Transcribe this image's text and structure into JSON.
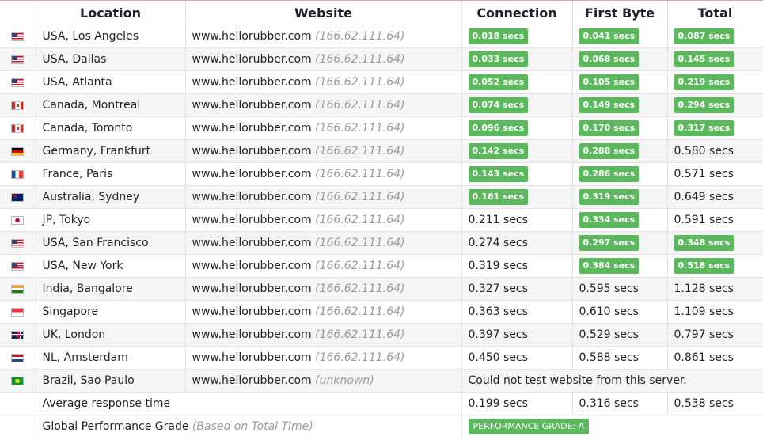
{
  "headers": [
    "Location",
    "Website",
    "Connection",
    "First Byte",
    "Total"
  ],
  "rows": [
    {
      "flag": "us-flag-icon",
      "flag_class": "f-us",
      "location": "USA, Los Angeles",
      "site": "www.hellorubber.com",
      "ip": "(166.62.111.64)",
      "connection": {
        "text": "0.018 secs",
        "badge": true
      },
      "first_byte": {
        "text": "0.041 secs",
        "badge": true
      },
      "total": {
        "text": "0.087 secs",
        "badge": true
      }
    },
    {
      "flag": "us-flag-icon",
      "flag_class": "f-us",
      "location": "USA, Dallas",
      "site": "www.hellorubber.com",
      "ip": "(166.62.111.64)",
      "connection": {
        "text": "0.033 secs",
        "badge": true
      },
      "first_byte": {
        "text": "0.068 secs",
        "badge": true
      },
      "total": {
        "text": "0.145 secs",
        "badge": true
      }
    },
    {
      "flag": "us-flag-icon",
      "flag_class": "f-us",
      "location": "USA, Atlanta",
      "site": "www.hellorubber.com",
      "ip": "(166.62.111.64)",
      "connection": {
        "text": "0.052 secs",
        "badge": true
      },
      "first_byte": {
        "text": "0.105 secs",
        "badge": true
      },
      "total": {
        "text": "0.219 secs",
        "badge": true
      }
    },
    {
      "flag": "canada-flag-icon",
      "flag_class": "f-ca",
      "location": "Canada, Montreal",
      "site": "www.hellorubber.com",
      "ip": "(166.62.111.64)",
      "connection": {
        "text": "0.074 secs",
        "badge": true
      },
      "first_byte": {
        "text": "0.149 secs",
        "badge": true
      },
      "total": {
        "text": "0.294 secs",
        "badge": true
      }
    },
    {
      "flag": "canada-flag-icon",
      "flag_class": "f-ca",
      "location": "Canada, Toronto",
      "site": "www.hellorubber.com",
      "ip": "(166.62.111.64)",
      "connection": {
        "text": "0.096 secs",
        "badge": true
      },
      "first_byte": {
        "text": "0.170 secs",
        "badge": true
      },
      "total": {
        "text": "0.317 secs",
        "badge": true
      }
    },
    {
      "flag": "germany-flag-icon",
      "flag_class": "f-de",
      "location": "Germany, Frankfurt",
      "site": "www.hellorubber.com",
      "ip": "(166.62.111.64)",
      "connection": {
        "text": "0.142 secs",
        "badge": true
      },
      "first_byte": {
        "text": "0.288 secs",
        "badge": true
      },
      "total": {
        "text": "0.580 secs",
        "badge": false
      }
    },
    {
      "flag": "france-flag-icon",
      "flag_class": "f-fr",
      "location": "France, Paris",
      "site": "www.hellorubber.com",
      "ip": "(166.62.111.64)",
      "connection": {
        "text": "0.143 secs",
        "badge": true
      },
      "first_byte": {
        "text": "0.286 secs",
        "badge": true
      },
      "total": {
        "text": "0.571 secs",
        "badge": false
      }
    },
    {
      "flag": "australia-flag-icon",
      "flag_class": "f-au",
      "location": "Australia, Sydney",
      "site": "www.hellorubber.com",
      "ip": "(166.62.111.64)",
      "connection": {
        "text": "0.161 secs",
        "badge": true
      },
      "first_byte": {
        "text": "0.319 secs",
        "badge": true
      },
      "total": {
        "text": "0.649 secs",
        "badge": false
      }
    },
    {
      "flag": "japan-flag-icon",
      "flag_class": "f-jp",
      "location": "JP, Tokyo",
      "site": "www.hellorubber.com",
      "ip": "(166.62.111.64)",
      "connection": {
        "text": "0.211 secs",
        "badge": false
      },
      "first_byte": {
        "text": "0.334 secs",
        "badge": true
      },
      "total": {
        "text": "0.591 secs",
        "badge": false
      }
    },
    {
      "flag": "us-flag-icon",
      "flag_class": "f-us",
      "location": "USA, San Francisco",
      "site": "www.hellorubber.com",
      "ip": "(166.62.111.64)",
      "connection": {
        "text": "0.274 secs",
        "badge": false
      },
      "first_byte": {
        "text": "0.297 secs",
        "badge": true
      },
      "total": {
        "text": "0.348 secs",
        "badge": true
      }
    },
    {
      "flag": "us-flag-icon",
      "flag_class": "f-us",
      "location": "USA, New York",
      "site": "www.hellorubber.com",
      "ip": "(166.62.111.64)",
      "connection": {
        "text": "0.319 secs",
        "badge": false
      },
      "first_byte": {
        "text": "0.384 secs",
        "badge": true
      },
      "total": {
        "text": "0.518 secs",
        "badge": true
      }
    },
    {
      "flag": "india-flag-icon",
      "flag_class": "f-in",
      "location": "India, Bangalore",
      "site": "www.hellorubber.com",
      "ip": "(166.62.111.64)",
      "connection": {
        "text": "0.327 secs",
        "badge": false
      },
      "first_byte": {
        "text": "0.595 secs",
        "badge": false
      },
      "total": {
        "text": "1.128 secs",
        "badge": false
      }
    },
    {
      "flag": "singapore-flag-icon",
      "flag_class": "f-sg",
      "location": "Singapore",
      "site": "www.hellorubber.com",
      "ip": "(166.62.111.64)",
      "connection": {
        "text": "0.363 secs",
        "badge": false
      },
      "first_byte": {
        "text": "0.610 secs",
        "badge": false
      },
      "total": {
        "text": "1.109 secs",
        "badge": false
      }
    },
    {
      "flag": "uk-flag-icon",
      "flag_class": "f-uk",
      "location": "UK, London",
      "site": "www.hellorubber.com",
      "ip": "(166.62.111.64)",
      "connection": {
        "text": "0.397 secs",
        "badge": false
      },
      "first_byte": {
        "text": "0.529 secs",
        "badge": false
      },
      "total": {
        "text": "0.797 secs",
        "badge": false
      }
    },
    {
      "flag": "netherlands-flag-icon",
      "flag_class": "f-nl",
      "location": "NL, Amsterdam",
      "site": "www.hellorubber.com",
      "ip": "(166.62.111.64)",
      "connection": {
        "text": "0.450 secs",
        "badge": false
      },
      "first_byte": {
        "text": "0.588 secs",
        "badge": false
      },
      "total": {
        "text": "0.861 secs",
        "badge": false
      }
    },
    {
      "flag": "brazil-flag-icon",
      "flag_class": "f-br",
      "location": "Brazil, Sao Paulo",
      "site": "www.hellorubber.com",
      "ip": "(unknown)",
      "error": "Could not test website from this server."
    }
  ],
  "average": {
    "label": "Average response time",
    "connection": "0.199 secs",
    "first_byte": "0.316 secs",
    "total": "0.538 secs"
  },
  "grade": {
    "label": "Global Performance Grade",
    "note": "(Based on Total Time)",
    "badge": "PERFORMANCE GRADE: A"
  },
  "colors": {
    "badge_green": "#5cb85c",
    "row_stripe": "#f5f5f5",
    "border": "#e3e3e3",
    "muted": "#9a9a9a"
  }
}
